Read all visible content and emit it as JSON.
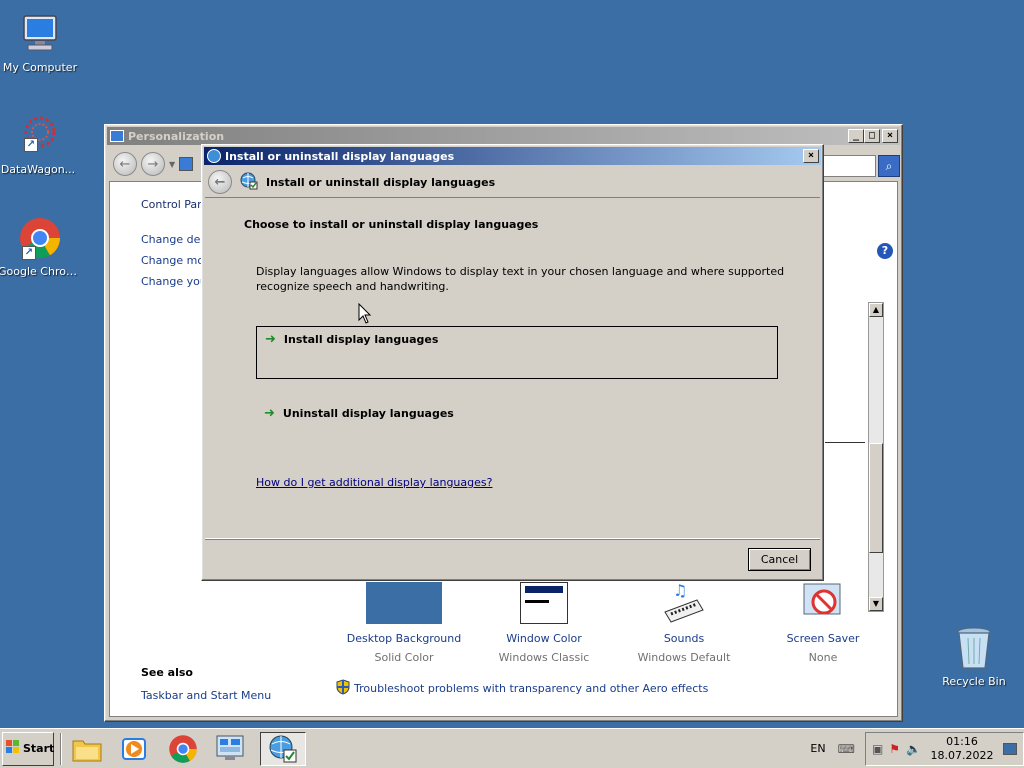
{
  "desktop": {
    "icons": [
      {
        "label": "My Computer"
      },
      {
        "label": "DataWagon..."
      },
      {
        "label": "Google Chrome"
      },
      {
        "label": "Recycle Bin"
      }
    ]
  },
  "personalization": {
    "title": "Personalization",
    "sidebar": {
      "control_panel": "Control Panel",
      "links": [
        "Change deskt",
        "Change mous",
        "Change your"
      ]
    },
    "themes": [
      {
        "name": "Desktop Background",
        "value": "Solid Color"
      },
      {
        "name": "Window Color",
        "value": "Windows Classic"
      },
      {
        "name": "Sounds",
        "value": "Windows Default"
      },
      {
        "name": "Screen Saver",
        "value": "None"
      }
    ],
    "see_also": "See also",
    "see_also_link": "Taskbar and Start Menu",
    "troubleshoot": "Troubleshoot problems with transparency and other Aero effects"
  },
  "dialog": {
    "title": "Install or uninstall display languages",
    "header": "Install or uninstall display languages",
    "heading": "Choose to install or uninstall display languages",
    "description": "Display languages allow Windows to display text in your chosen language and where supported recognize speech and handwriting.",
    "option_install": "Install display languages",
    "option_uninstall": "Uninstall display languages",
    "help_link": "How do I get additional display languages?",
    "cancel": "Cancel"
  },
  "taskbar": {
    "start": "Start",
    "lang": "EN",
    "time": "01:16",
    "date": "18.07.2022"
  },
  "colors": {
    "desktop": "#3a6ea5",
    "title_active": "#0a246a",
    "link": "#1a3c8c"
  }
}
